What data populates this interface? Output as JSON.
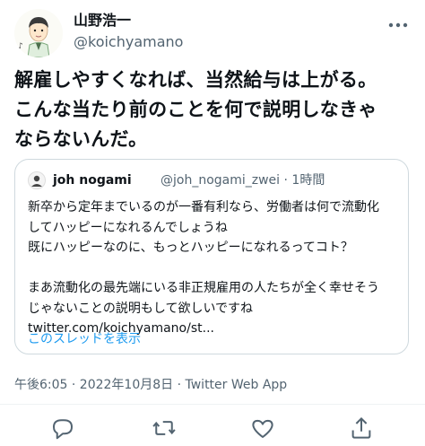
{
  "author": {
    "display_name": "山野浩一",
    "handle": "@koichyamano"
  },
  "tweet": {
    "lines": [
      "解雇しやすくなれば、当然給与は上がる。",
      "こんな当たり前のことを何で説明しなきゃ",
      "ならないんだ。"
    ]
  },
  "quote": {
    "name": "joh nogami",
    "handle_time": "@joh_nogami_zwei · 1時間",
    "lines": [
      "新卒から定年までいるのが一番有利なら、労働者は何で流動化",
      "してハッピーになれるんでしょうね",
      "既にハッピーなのに、もっとハッピーになれるってコト？",
      "",
      "まあ流動化の最先端にいる非正規雇用の人たちが全く幸せそう",
      "じゃないことの説明もして欲しいですね",
      "twitter.com/koichyamano/st..."
    ],
    "thread_link": "このスレッドを表示"
  },
  "meta": {
    "timestamp": "午後6:05 · 2022年10月8日 · Twitter Web App"
  },
  "colors": {
    "text": "#0f1419",
    "secondary": "#536471",
    "accent": "#1d9bf0",
    "border": "#cfd9de"
  },
  "icons": [
    "more-icon",
    "reply-icon",
    "retweet-icon",
    "like-icon",
    "share-icon"
  ]
}
